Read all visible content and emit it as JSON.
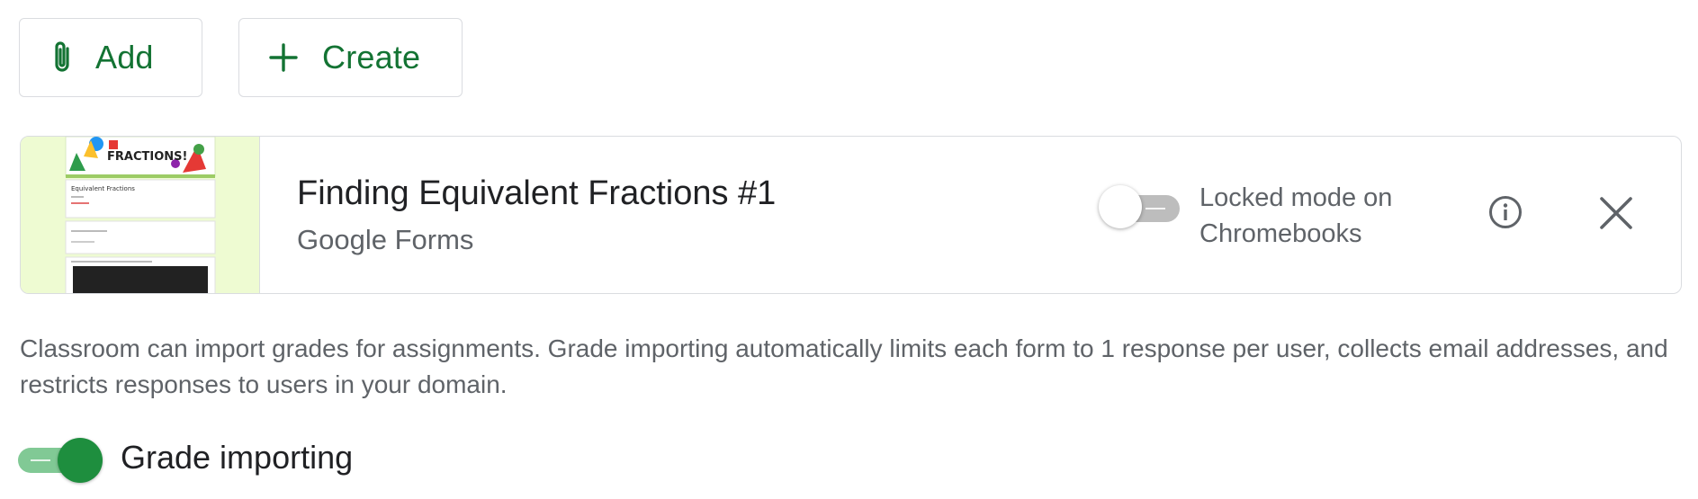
{
  "toolbar": {
    "add_label": "Add",
    "create_label": "Create",
    "accent_color": "#137333"
  },
  "attachment": {
    "title": "Finding Equivalent Fractions #1",
    "type": "Google Forms",
    "thumbnail": {
      "banner_text": "FRACTIONS!",
      "heading": "Equivalent Fractions"
    },
    "locked_mode": {
      "label": "Locked mode on Chromebooks",
      "enabled": false
    }
  },
  "description": "Classroom can import grades for assignments. Grade importing automatically limits each form to 1 response per user, collects email addresses, and restricts responses to users in your domain.",
  "grade_importing": {
    "label": "Grade importing",
    "enabled": true,
    "color": "#1e8e3e"
  },
  "icons": [
    "paperclip-icon",
    "plus-icon",
    "info-icon",
    "close-icon"
  ]
}
